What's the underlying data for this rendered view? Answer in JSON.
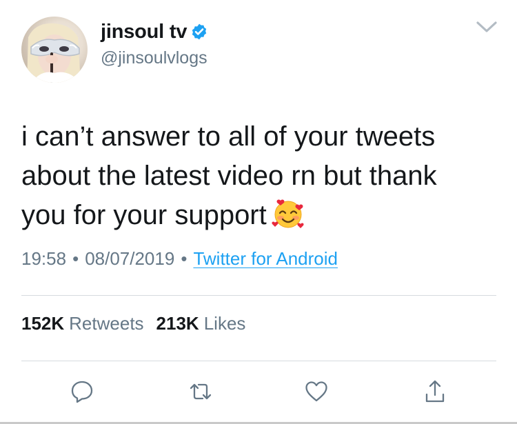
{
  "user": {
    "display_name": "jinsoul tv",
    "handle": "@jinsoulvlogs"
  },
  "tweet": {
    "text": "i can’t answer to all of your tweets\nabout the latest video rn but thank\nyou for your support",
    "emoji": "smiling-face-with-hearts"
  },
  "meta": {
    "time": "19:58",
    "separator": "•",
    "date": "08/07/2019",
    "source": "Twitter for Android"
  },
  "stats": {
    "retweets_count": "152K",
    "retweets_label": "Retweets",
    "likes_count": "213K",
    "likes_label": "Likes"
  },
  "icons": {
    "verified": "verified-badge-icon",
    "menu": "chevron-down-icon",
    "reply": "reply-icon",
    "retweet": "retweet-icon",
    "like": "heart-icon",
    "share": "share-icon"
  },
  "colors": {
    "text": "#14171a",
    "secondary": "#657786",
    "link": "#1da1f2",
    "divider": "#d6dadf"
  }
}
